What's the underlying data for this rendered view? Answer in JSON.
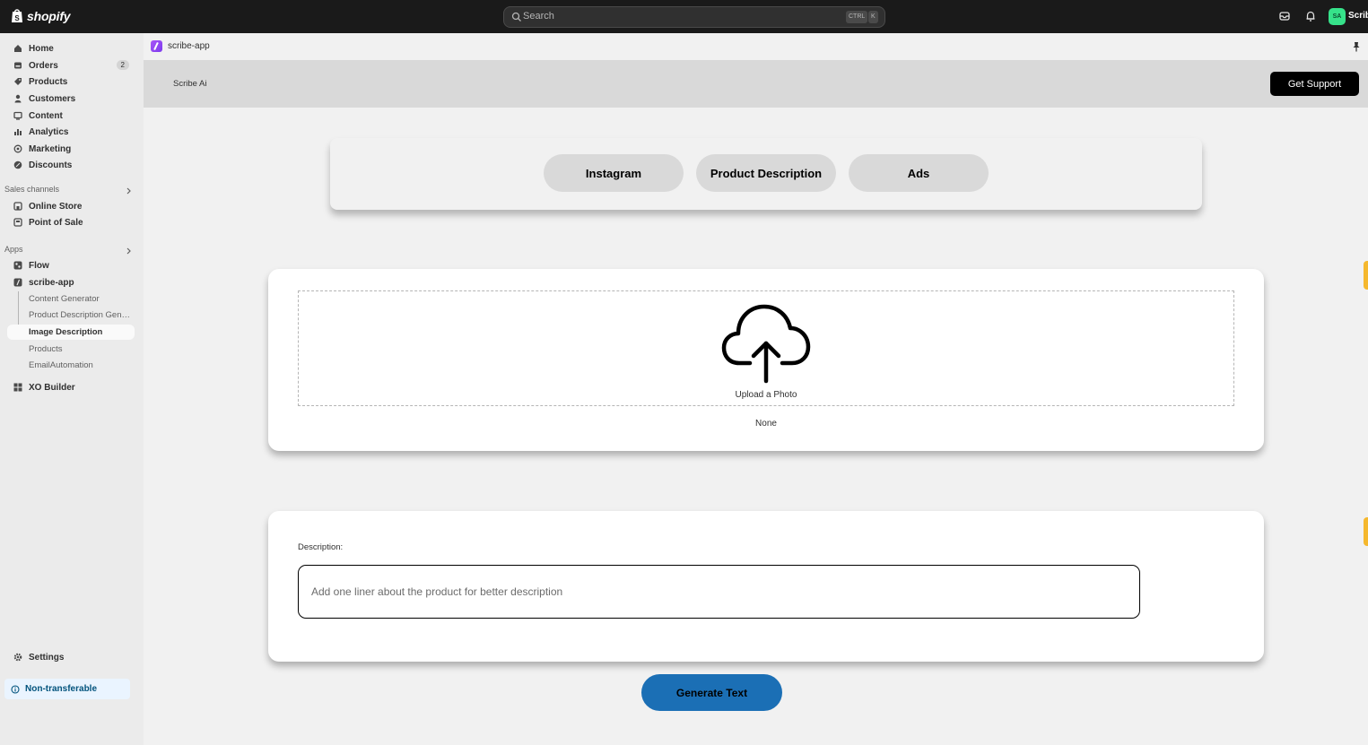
{
  "topbar": {
    "brand": "shopify",
    "search_placeholder": "Search",
    "shortcut_ctrl": "CTRL",
    "shortcut_key": "K",
    "avatar_initials": "SA",
    "store_name": "Scribe"
  },
  "sidebar": {
    "items": [
      {
        "label": "Home",
        "icon": "home-icon"
      },
      {
        "label": "Orders",
        "icon": "orders-icon",
        "badge": "2"
      },
      {
        "label": "Products",
        "icon": "tag-icon"
      },
      {
        "label": "Customers",
        "icon": "person-icon"
      },
      {
        "label": "Content",
        "icon": "content-icon"
      },
      {
        "label": "Analytics",
        "icon": "bar-chart-icon"
      },
      {
        "label": "Marketing",
        "icon": "target-icon"
      },
      {
        "label": "Discounts",
        "icon": "discount-icon"
      }
    ],
    "sales_channels_label": "Sales channels",
    "sales_channels": [
      {
        "label": "Online Store",
        "icon": "store-icon"
      },
      {
        "label": "Point of Sale",
        "icon": "pos-icon"
      }
    ],
    "apps_label": "Apps",
    "apps": [
      {
        "label": "Flow",
        "icon": "flow-icon"
      },
      {
        "label": "scribe-app",
        "icon": "scribe-icon"
      }
    ],
    "scribe_subitems": [
      "Content Generator",
      "Product Description Generator",
      "Image Description",
      "Products",
      "EmailAutomation"
    ],
    "xo_builder": "XO Builder",
    "settings": "Settings",
    "non_transferable": "Non-transferable"
  },
  "app_header": {
    "app_name": "scribe-app"
  },
  "banner": {
    "title": "Scribe Ai",
    "support_button": "Get Support"
  },
  "tabs": [
    "Instagram",
    "Product Description",
    "Ads"
  ],
  "upload": {
    "label": "Upload a Photo",
    "file_status": "None"
  },
  "description": {
    "label": "Description:",
    "placeholder": "Add one liner about the product for better description",
    "value": ""
  },
  "generate_button": "Generate Text",
  "colors": {
    "topbar_bg": "#1a1a1a",
    "accent_blue": "#1b6fb5",
    "avatar_green": "#36e28a",
    "app_icon_purple": "#7c3aed",
    "side_tab_yellow": "#f5b82e"
  }
}
